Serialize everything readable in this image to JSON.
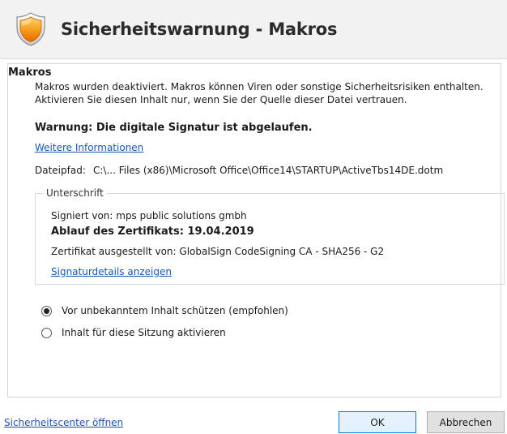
{
  "dialog": {
    "title": "Sicherheitswarnung - Makros",
    "icon": "security-shield-icon"
  },
  "macros": {
    "section_title": "Makros",
    "description": "Makros wurden deaktiviert. Makros können Viren oder sonstige Sicherheitsrisiken enthalten. Aktivieren Sie diesen Inhalt nur, wenn Sie der Quelle dieser Datei vertrauen.",
    "warning": "Warnung: Die digitale Signatur ist abgelaufen.",
    "more_info_link": "Weitere Informationen",
    "file_path_label": "Dateipfad:",
    "file_path_value": "C:\\... Files (x86)\\Microsoft Office\\Office14\\STARTUP\\ActiveTbs14DE.dotm"
  },
  "signature": {
    "legend": "Unterschrift",
    "signed_by": "Signiert von: mps public solutions gmbh",
    "expiry": "Ablauf des Zertifikats: 19.04.2019",
    "issuer": "Zertifikat ausgestellt von: GlobalSign CodeSigning CA - SHA256 - G2",
    "details_link": "Signaturdetails anzeigen"
  },
  "options": [
    {
      "label": "Vor unbekanntem Inhalt schützen (empfohlen)",
      "checked": true
    },
    {
      "label": "Inhalt für diese Sitzung aktivieren",
      "checked": false
    }
  ],
  "footer": {
    "trust_center_link": "Sicherheitscenter öffnen",
    "ok_label": "OK",
    "cancel_label": "Abbrechen"
  },
  "colors": {
    "link": "#1c56b0",
    "header_bg": "#f2f2f2",
    "shield_orange": "#f08a00"
  }
}
